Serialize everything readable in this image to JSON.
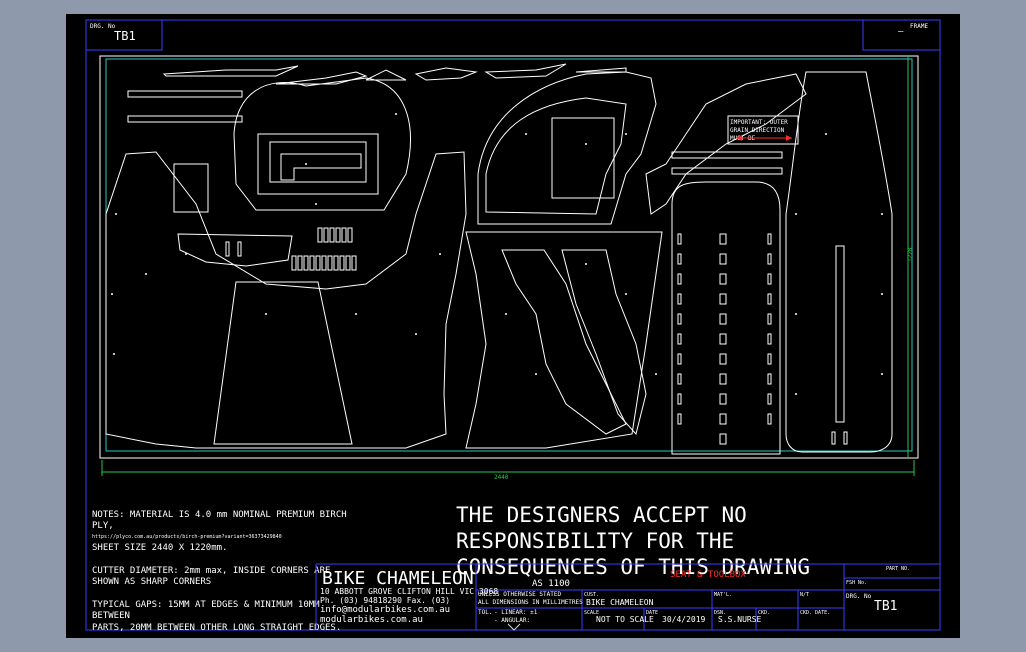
{
  "header": {
    "drg_no_label": "DRG. No",
    "drg_no_value": "TB1",
    "frame_label": "FRAME",
    "frame_value": "–"
  },
  "dimensions": {
    "width": "2440",
    "height": "1220"
  },
  "important_note": [
    "IMPORTANT: OUTER",
    "GRAIN DIRECTION",
    "MUST BE"
  ],
  "notes": {
    "material": [
      "NOTES: MATERIAL IS 4.0 mm NOMINAL PREMIUM BIRCH",
      "PLY,"
    ],
    "url": "https://plyco.com.au/products/birch-premium?variant=36373429840",
    "sheet_size": "SHEET SIZE 2440 X 1220mm.",
    "cutter": [
      "CUTTER DIAMETER: 2mm max, INSIDE CORNERS ARE",
      "SHOWN AS SHARP CORNERS"
    ],
    "gaps": [
      "TYPICAL GAPS: 15MM AT EDGES & MINIMUM 10MM",
      "BETWEEN",
      "PARTS, 20MM BETWEEN OTHER LONG STRAIGHT EDGES."
    ]
  },
  "disclaimer": [
    "THE DESIGNERS ACCEPT NO",
    "RESPONSIBILITY FOR THE",
    "CONSEQUENCES OF THIS DRAWING"
  ],
  "red_note": "SEAT & TOOLBOX",
  "company": {
    "name": "BIKE CHAMELEON",
    "address": "10 ABBOTT GROVE CLIFTON HILL VIC 3068",
    "phone": "Ph. (03) 94818290 Fax. (03)",
    "email": "info@modularbikes.com.au",
    "web": "modularbikes.com.au"
  },
  "title_block": {
    "standard": "AS 1100",
    "otherwise": "UNLESS OTHERWISE STATED",
    "dims": "ALL DIMENSIONS IN MILLIMETRES",
    "tol": "TOL.",
    "linear": "- LINEAR: ±1",
    "angular": "- ANGULAR:",
    "cust_label": "CUST.",
    "project": "BIKE CHAMELEON",
    "scale_label": "SCALE",
    "scale_value": "NOT TO SCALE",
    "date_label": "DATE",
    "date_value": "30/4/2019",
    "matl_label": "MAT'L.",
    "nt_label": "N/T",
    "dsn_label": "DSN.",
    "dsn_value": "S.S.NURSE",
    "ckd_label": "CKD.",
    "ckd_date_label": "CKD. DATE.",
    "drg_no_label": "DRG. No",
    "drg_no_value": "TB1",
    "part_no_label": "PART NO.",
    "fsh_no_label": "FSH No."
  },
  "colors": {
    "background": "#8e9aac",
    "sheet": "#000000",
    "frame": "#3b3bff",
    "lines": "#ffffff",
    "cyan": "#29c7c7",
    "green": "#22c84a",
    "red": "#ff2a2a"
  }
}
